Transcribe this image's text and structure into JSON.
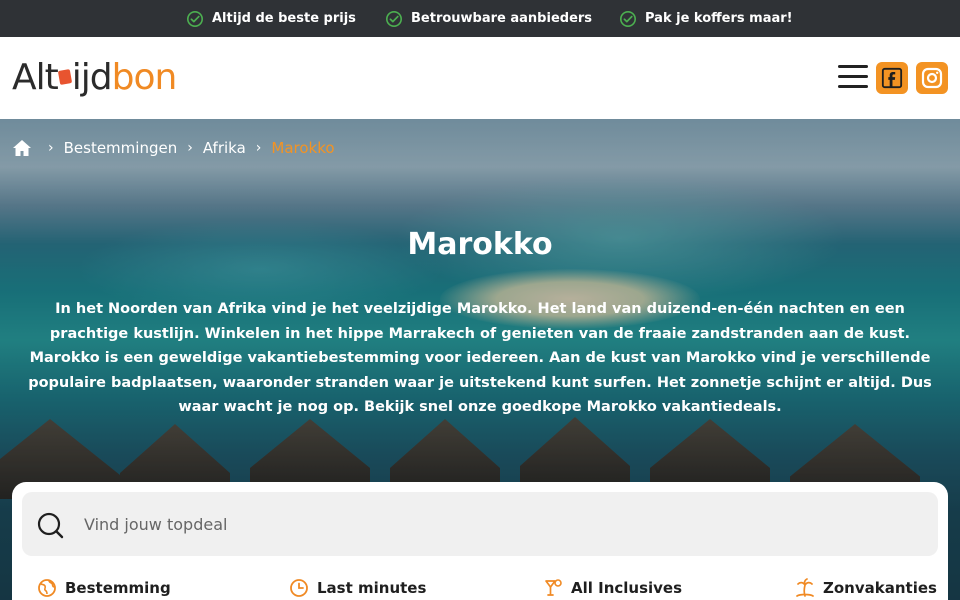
{
  "usp_bar": {
    "items": [
      {
        "label": "Altijd de beste prijs",
        "icon": "check-circle-icon"
      },
      {
        "label": "Betrouwbare aanbieders",
        "icon": "check-circle-icon"
      },
      {
        "label": "Pak je koffers maar!",
        "icon": "check-circle-icon"
      }
    ],
    "icon_color": "#4caf50"
  },
  "header": {
    "logo": {
      "part1": "Alt",
      "part2": "ijd",
      "part3": "bon"
    },
    "menu_icon": "hamburger-menu-icon",
    "social": [
      "facebook-icon",
      "instagram-icon"
    ],
    "accent": "#f39323"
  },
  "breadcrumb": {
    "home_icon": "home-icon",
    "items": [
      "Bestemmingen",
      "Afrika"
    ],
    "current": "Marokko",
    "separator": "›"
  },
  "hero": {
    "title": "Marokko",
    "description": "In het Noorden van Afrika vind je het veelzijdige Marokko. Het land van duizend-en-één nachten en een prachtige kustlijn. Winkelen in het hippe Marrakech of genieten van de fraaie zandstranden aan de kust. Marokko is een geweldige vakantiebestemming voor iedereen. Aan de kust van Marokko vind je verschillende populaire badplaatsen, waaronder stranden waar je uitstekend kunt surfen. Het zonnetje schijnt er altijd. Dus waar wacht je nog op. Bekijk snel onze goedkope Marokko vakantiedeals."
  },
  "search": {
    "placeholder": "Vind jouw topdeal",
    "value": "",
    "icon": "search-icon"
  },
  "categories": [
    {
      "label": "Bestemming",
      "icon": "globe-icon"
    },
    {
      "label": "Last minutes",
      "icon": "clock-icon"
    },
    {
      "label": "All Inclusives",
      "icon": "cocktail-icon"
    },
    {
      "label": "Zonvakanties",
      "icon": "palm-tree-icon"
    }
  ]
}
